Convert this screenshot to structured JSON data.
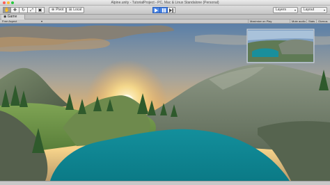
{
  "window": {
    "title": "Alpine.unity - TutorialProject - PC, Mac & Linux Standalone (Personal)"
  },
  "toolbar": {
    "transform_tools": [
      {
        "name": "hand-tool-icon",
        "glyph": "✋"
      },
      {
        "name": "move-tool-icon",
        "glyph": "✥"
      },
      {
        "name": "rotate-tool-icon",
        "glyph": "↻"
      },
      {
        "name": "scale-tool-icon",
        "glyph": "⤢"
      },
      {
        "name": "rect-tool-icon",
        "glyph": "▣"
      }
    ],
    "pivot_label": "Pivot",
    "local_label": "Local",
    "play_icon": "play-icon",
    "pause_icon": "pause-icon",
    "step_icon": "step-icon",
    "layers_label": "Layers",
    "layout_label": "Layout"
  },
  "game_view": {
    "tab_label": "Game",
    "aspect_value": "Free Aspect",
    "maximize_on_play": "Maximize on Play",
    "mute_audio": "Mute audio",
    "stats": "Stats",
    "gizmos": "Gizmos"
  },
  "colors": {
    "accent_blue": "#4b86e6",
    "water": "#0f8a96",
    "sky_glow": "#f5b85a"
  }
}
